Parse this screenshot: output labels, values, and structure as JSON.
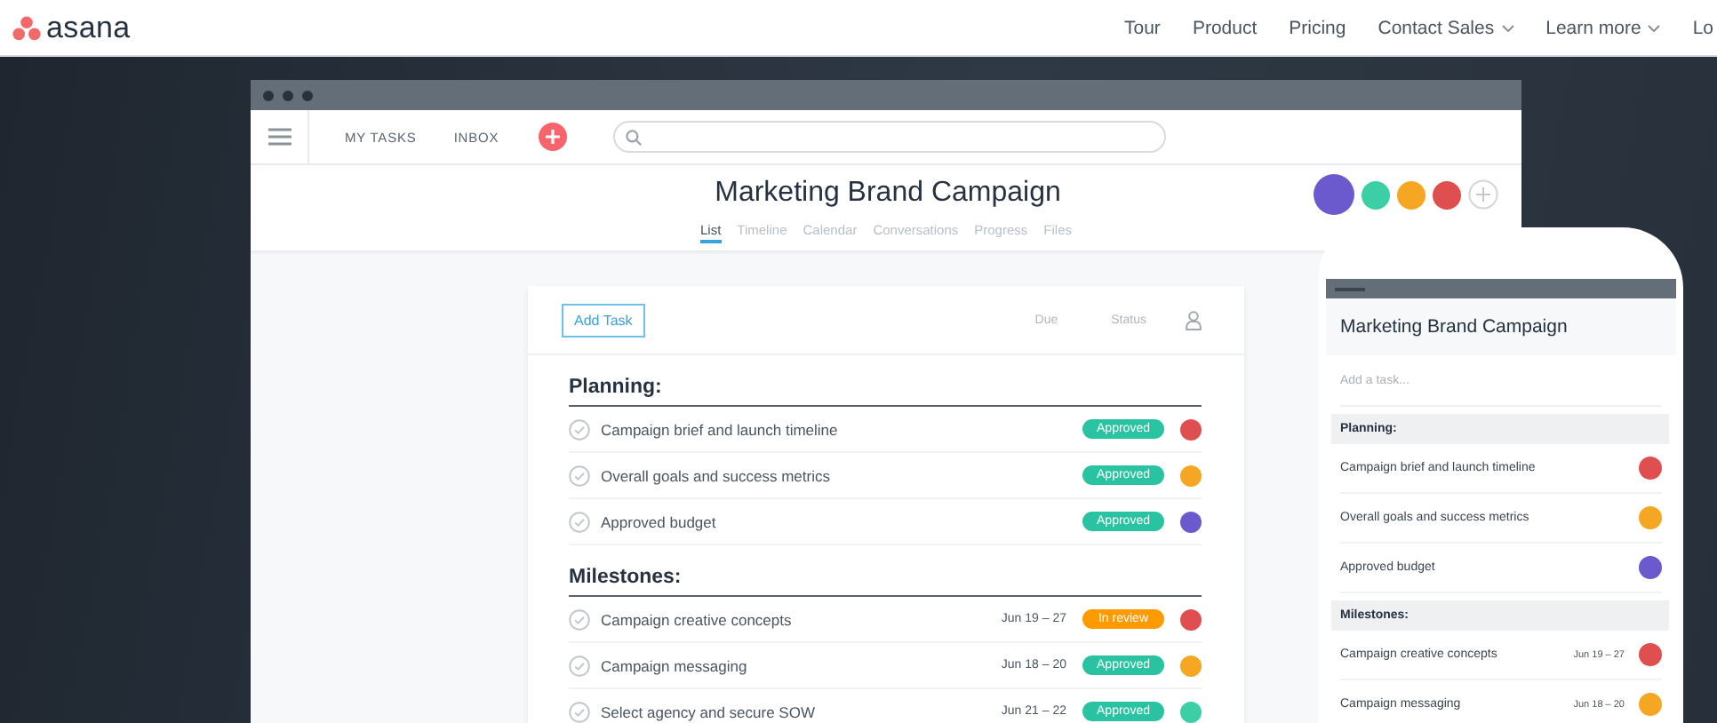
{
  "site_nav": {
    "logo": "asana",
    "links": [
      {
        "label": "Tour",
        "dropdown": false
      },
      {
        "label": "Product",
        "dropdown": false
      },
      {
        "label": "Pricing",
        "dropdown": false
      },
      {
        "label": "Contact Sales",
        "dropdown": true
      },
      {
        "label": "Learn more",
        "dropdown": true
      },
      {
        "label": "Lo",
        "dropdown": false
      }
    ]
  },
  "desktop_app": {
    "toolbar": {
      "items": [
        "MY TASKS",
        "INBOX"
      ]
    },
    "project": {
      "title": "Marketing Brand Campaign",
      "tabs": [
        {
          "label": "List",
          "selected": true
        },
        {
          "label": "Timeline",
          "selected": false
        },
        {
          "label": "Calendar",
          "selected": false
        },
        {
          "label": "Conversations",
          "selected": false
        },
        {
          "label": "Progress",
          "selected": false
        },
        {
          "label": "Files",
          "selected": false
        }
      ],
      "members": [
        {
          "color": "#6a5acd"
        },
        {
          "color": "#3ccfa6"
        },
        {
          "color": "#f5a623"
        },
        {
          "color": "#e04f4f"
        }
      ]
    },
    "list": {
      "add_button": "Add Task",
      "columns": [
        "Due",
        "Status"
      ],
      "sections": [
        {
          "title": "Planning:",
          "tasks": [
            {
              "name": "Campaign brief and launch timeline",
              "status": "Approved",
              "kind": "approved",
              "color": "#e04f4f"
            },
            {
              "name": "Overall goals and success metrics",
              "status": "Approved",
              "kind": "approved",
              "color": "#f5a623"
            },
            {
              "name": "Approved budget",
              "status": "Approved",
              "kind": "approved",
              "color": "#6a5acd"
            }
          ]
        },
        {
          "title": "Milestones:",
          "tasks": [
            {
              "name": "Campaign creative concepts",
              "due": "Jun 19 – 27",
              "status": "In review",
              "kind": "review",
              "color": "#e04f4f"
            },
            {
              "name": "Campaign messaging",
              "due": "Jun 18 – 20",
              "status": "Approved",
              "kind": "approved",
              "color": "#f5a623"
            },
            {
              "name": "Select agency and secure SOW",
              "due": "Jun 21 – 22",
              "status": "Approved",
              "kind": "approved",
              "color": "#3ccfa6"
            }
          ]
        }
      ]
    }
  },
  "phone_app": {
    "title": "Marketing Brand Campaign",
    "add_task": {
      "placeholder": "Add a task..."
    },
    "sections": [
      {
        "title": "Planning:",
        "tasks": [
          {
            "name": "Campaign brief and launch timeline",
            "color": "#e04f4f"
          },
          {
            "name": "Overall goals and success metrics",
            "color": "#f5a623"
          },
          {
            "name": "Approved budget",
            "color": "#6a5acd"
          }
        ]
      },
      {
        "title": "Milestones:",
        "tasks": [
          {
            "name": "Campaign creative concepts",
            "due": "Jun 19 – 27",
            "color": "#e04f4f"
          },
          {
            "name": "Campaign messaging",
            "due": "Jun 18 – 20",
            "color": "#f5a623"
          }
        ]
      }
    ]
  }
}
